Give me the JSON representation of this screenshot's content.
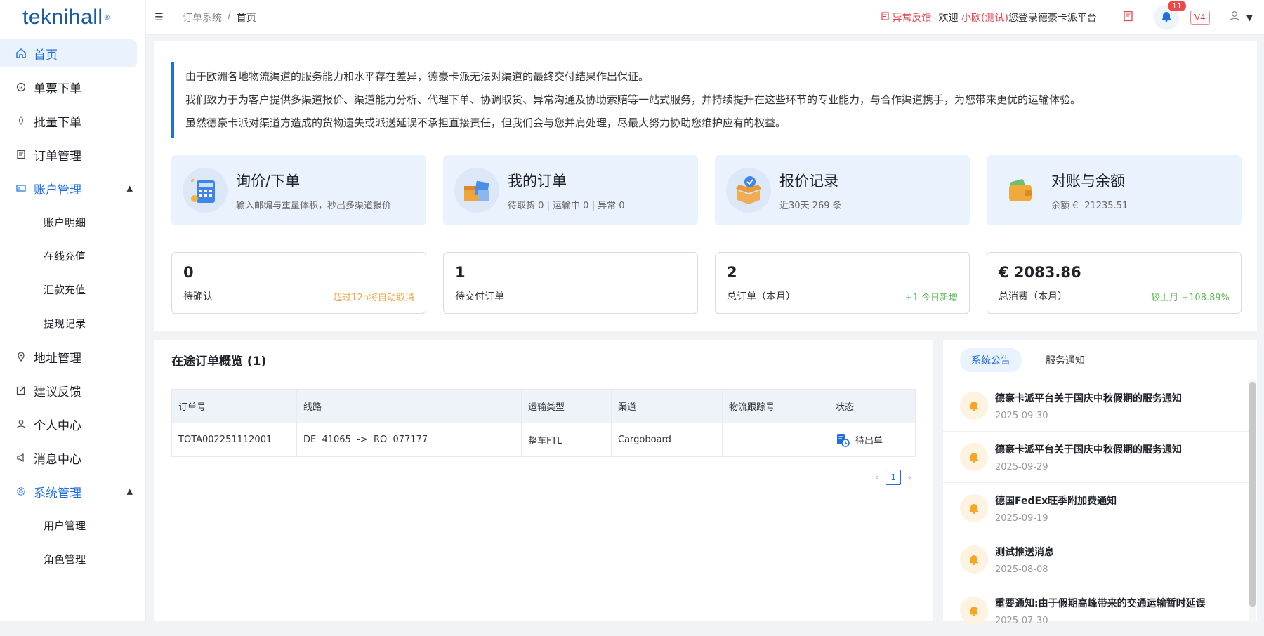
{
  "logo": {
    "text": "teknihall",
    "mark": "®"
  },
  "sidebar": {
    "items": [
      {
        "label": "首页",
        "icon": "home-icon"
      },
      {
        "label": "单票下单",
        "icon": "single-order-icon"
      },
      {
        "label": "批量下单",
        "icon": "batch-order-icon"
      },
      {
        "label": "订单管理",
        "icon": "order-manage-icon"
      },
      {
        "label": "账户管理",
        "icon": "account-icon"
      },
      {
        "label": "账户明细"
      },
      {
        "label": "在线充值"
      },
      {
        "label": "汇款充值"
      },
      {
        "label": "提现记录"
      },
      {
        "label": "地址管理",
        "icon": "location-icon"
      },
      {
        "label": "建议反馈",
        "icon": "edit-icon"
      },
      {
        "label": "个人中心",
        "icon": "user-icon"
      },
      {
        "label": "消息中心",
        "icon": "megaphone-icon"
      },
      {
        "label": "系统管理",
        "icon": "gear-icon"
      },
      {
        "label": "用户管理"
      },
      {
        "label": "角色管理"
      }
    ]
  },
  "header": {
    "breadcrumb": [
      "订单系统",
      "/",
      "首页"
    ],
    "feedback": "异常反馈",
    "welcome_pre": "欢迎",
    "username": "小欧(测试)",
    "welcome_post": "您登录德豪卡派平台",
    "bell_count": "11",
    "version": "V4"
  },
  "notice": [
    "由于欧洲各地物流渠道的服务能力和水平存在差异，德豪卡派无法对渠道的最终交付结果作出保证。",
    "我们致力于为客户提供多渠道报价、渠道能力分析、代理下单、协调取货、异常沟通及协助索赔等一站式服务，并持续提升在这些环节的专业能力，与合作渠道携手，为您带来更优的运输体验。",
    "虽然德豪卡派对渠道方造成的货物遗失或派送延误不承担直接责任，但我们会与您并肩处理，尽最大努力协助您维护应有的权益。"
  ],
  "quick_cards": [
    {
      "title": "询价/下单",
      "sub": "输入邮编与重量体积，秒出多渠道报价"
    },
    {
      "title": "我的订单",
      "sub": "待取货 0 | 运输中 0 | 异常 0"
    },
    {
      "title": "报价记录",
      "sub": "近30天 269 条"
    },
    {
      "title": "对账与余额",
      "sub": "余额 € -21235.51"
    }
  ],
  "stat_cards": [
    {
      "value": "0",
      "label": "待确认",
      "note": "超过12h将自动取消"
    },
    {
      "value": "1",
      "label": "待交付订单",
      "note": ""
    },
    {
      "value": "2",
      "label": "总订单（本月）",
      "note": "+1 今日新增"
    },
    {
      "value": "€ 2083.86",
      "label": "总消费（本月）",
      "note": "较上月 +108.89%"
    }
  ],
  "orders": {
    "title": "在途订单概览 (1)",
    "columns": [
      "订单号",
      "线路",
      "运输类型",
      "渠道",
      "物流跟踪号",
      "状态"
    ],
    "rows": [
      [
        "TOTA002251112001",
        "DE  41065  ->  RO  077177",
        "整车FTL",
        "Cargoboard",
        "",
        "待出单"
      ]
    ],
    "page": "1"
  },
  "announcements": {
    "tabs": [
      "系统公告",
      "服务通知"
    ],
    "items": [
      {
        "title": "德豪卡派平台关于国庆中秋假期的服务通知",
        "date": "2025-09-30"
      },
      {
        "title": "德豪卡派平台关于国庆中秋假期的服务通知",
        "date": "2025-09-29"
      },
      {
        "title": "德国FedEx旺季附加费通知",
        "date": "2025-09-19"
      },
      {
        "title": "测试推送消息",
        "date": "2025-08-08"
      },
      {
        "title": "重要通知:由于假期高峰带来的交通运输暂时延误",
        "date": "2025-07-30"
      }
    ]
  },
  "colors": {
    "accent": "#1f6fe0",
    "danger": "#e0454e",
    "warning": "#f5a64a",
    "success": "#5fb85a"
  }
}
